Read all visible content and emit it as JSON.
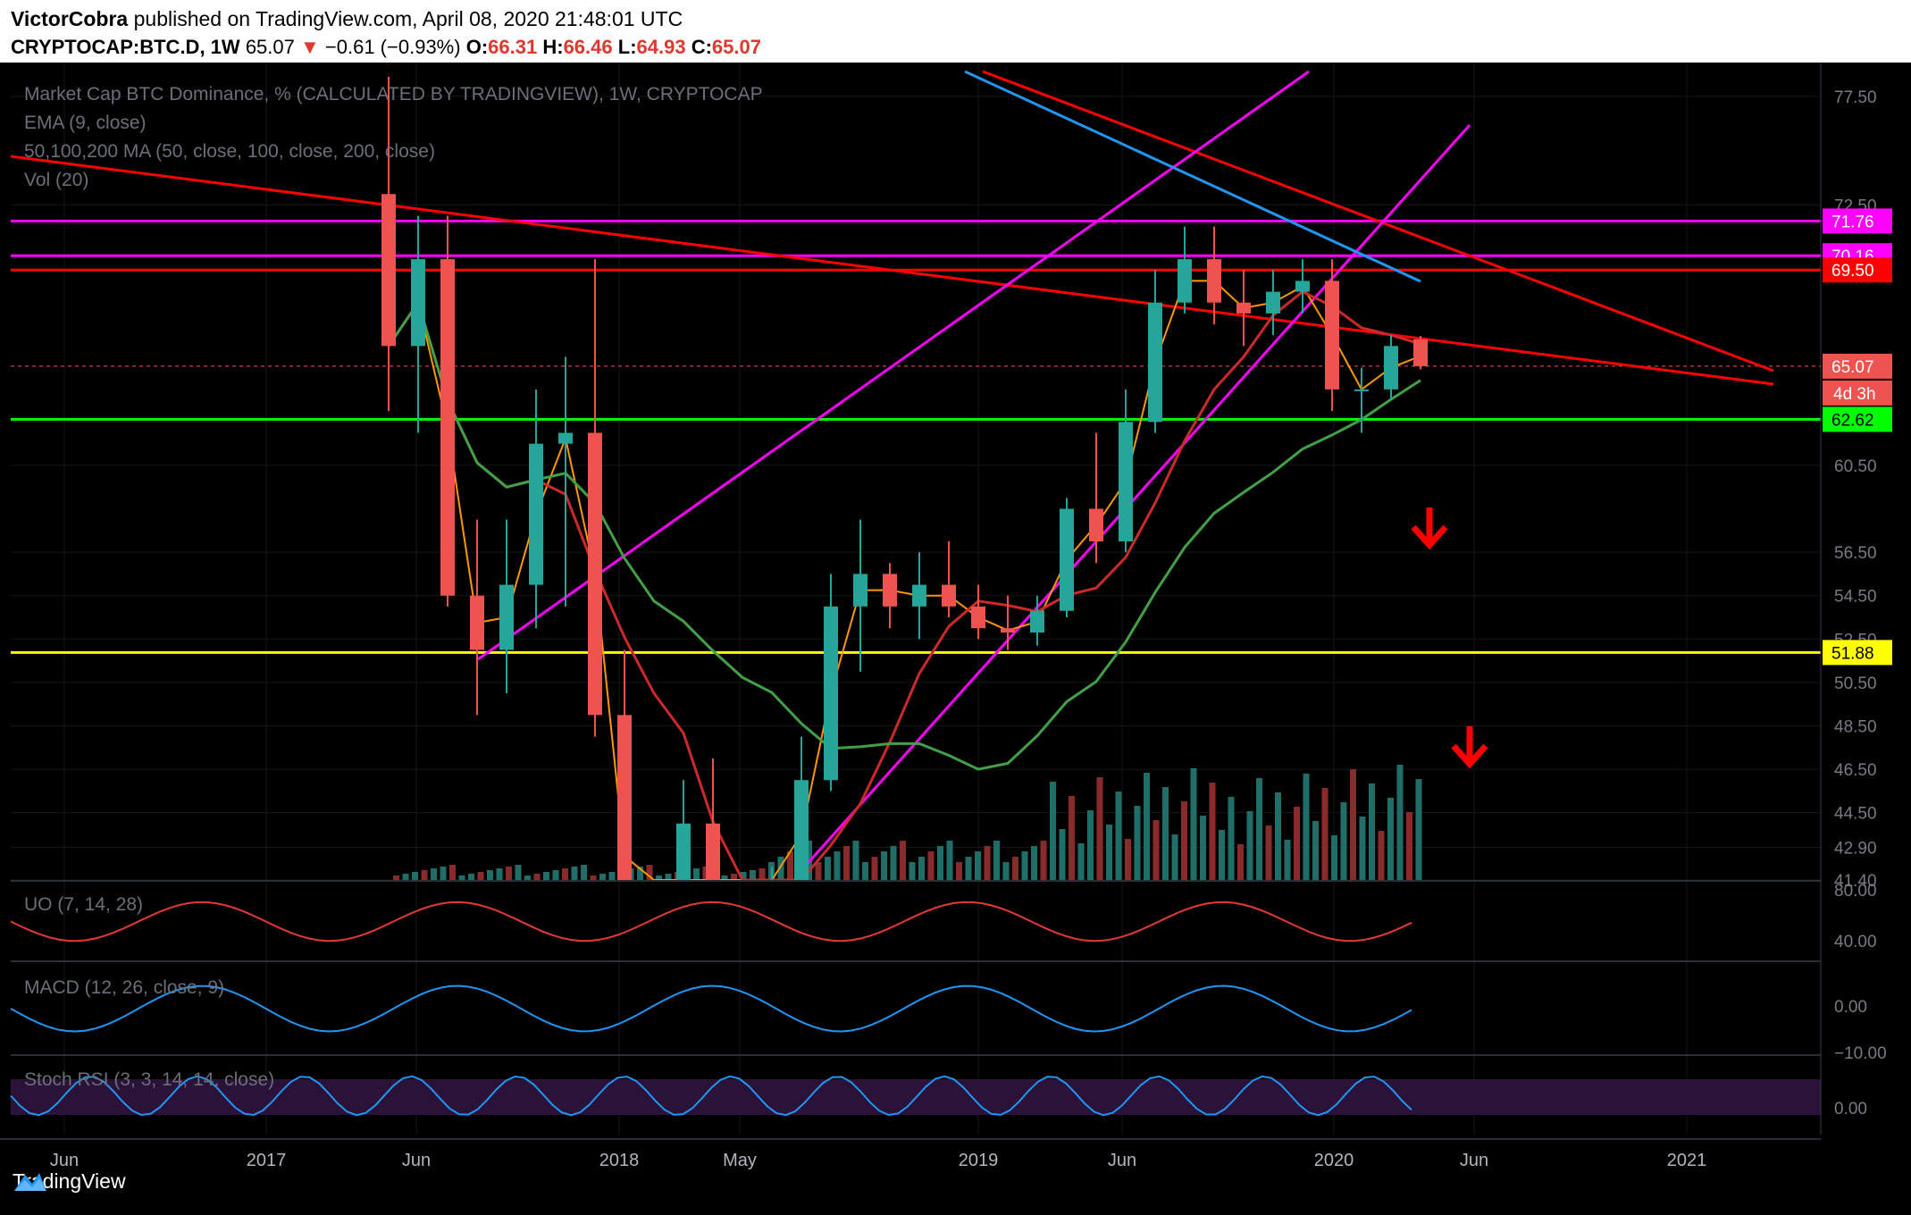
{
  "header": {
    "author": "VictorCobra",
    "published": " published on TradingView.com, April 08, 2020 21:48:01 UTC",
    "symbol": "CRYPTOCAP:BTC.D, 1W",
    "last": "65.07",
    "change": "−0.61 (−0.93%)",
    "o_label": "O:",
    "o": "66.31",
    "h_label": "H:",
    "h": "66.46",
    "l_label": "L:",
    "l": "64.93",
    "c_label": "C:",
    "c": "65.07"
  },
  "legends": {
    "title": "Market Cap BTC Dominance, % (CALCULATED BY TRADINGVIEW), 1W, CRYPTOCAP",
    "ema": "EMA (9, close)",
    "ma": "50,100,200 MA (50, close, 100, close, 200, close)",
    "vol": "Vol (20)",
    "uo": "UO (7, 14, 28)",
    "macd": "MACD (12, 26, close, 9)",
    "stoch": "Stoch RSI (3, 3, 14, 14, close)"
  },
  "footer": {
    "brand": "TradingView"
  },
  "colors": {
    "bg": "#000000",
    "up": "#26a69a",
    "down": "#ef5350",
    "magenta": "#ff00ff",
    "red": "#ff0000",
    "green_line": "#00ff00",
    "yellow": "#ffff00",
    "ema": "#ff9800",
    "ma50": "#cc2a2a",
    "ma100": "#43a047",
    "ma200": "#2196f3"
  },
  "chart_data": {
    "type": "candlestick",
    "timeframe": "1W",
    "x_ticks": [
      "Jun",
      "2017",
      "Jun",
      "2018",
      "May",
      "2019",
      "Jun",
      "2020",
      "Jun",
      "2021"
    ],
    "y_ticks": [
      77.5,
      72.5,
      60.5,
      56.5,
      54.5,
      52.5,
      50.5,
      48.5,
      46.5,
      44.5,
      42.9,
      41.4
    ],
    "y_tick_labels": [
      "77.50",
      "72.50",
      "60.50",
      "56.50",
      "54.50",
      "52.50",
      "50.50",
      "48.50",
      "46.50",
      "44.50",
      "42.90",
      "41.40"
    ],
    "y_range": [
      41.4,
      78.4
    ],
    "price_markers": [
      {
        "value": 71.76,
        "label": "71.76",
        "color": "#ff00ff"
      },
      {
        "value": 70.16,
        "label": "70.16",
        "color": "#ff00ff"
      },
      {
        "value": 69.5,
        "label": "69.50",
        "color": "#ff0000"
      },
      {
        "value": 65.07,
        "label": "65.07",
        "color": "#ef5350",
        "sub": "4d 3h"
      },
      {
        "value": 62.62,
        "label": "62.62",
        "color": "#00ff00"
      },
      {
        "value": 51.88,
        "label": "51.88",
        "color": "#ffff00"
      }
    ],
    "candles_approx": [
      {
        "t": "2017-05",
        "o": 73.0,
        "h": 78.4,
        "l": 63.0,
        "c": 66.0
      },
      {
        "t": "2017-06",
        "o": 66.0,
        "h": 72.0,
        "l": 62.0,
        "c": 70.0
      },
      {
        "t": "2017-07",
        "o": 70.0,
        "h": 72.0,
        "l": 54.0,
        "c": 54.5
      },
      {
        "t": "2017-08",
        "o": 54.5,
        "h": 58.0,
        "l": 49.0,
        "c": 52.0
      },
      {
        "t": "2017-09",
        "o": 52.0,
        "h": 58.0,
        "l": 50.0,
        "c": 55.0
      },
      {
        "t": "2017-10",
        "o": 55.0,
        "h": 64.0,
        "l": 53.0,
        "c": 61.5
      },
      {
        "t": "2017-11",
        "o": 61.5,
        "h": 65.5,
        "l": 54.0,
        "c": 62.0
      },
      {
        "t": "2017-12",
        "o": 62.0,
        "h": 70.0,
        "l": 48.0,
        "c": 49.0
      },
      {
        "t": "2018-01",
        "o": 49.0,
        "h": 52.0,
        "l": 33.0,
        "c": 36.0
      },
      {
        "t": "2018-02",
        "o": 36.0,
        "h": 38.0,
        "l": 33.5,
        "c": 36.5
      },
      {
        "t": "2018-03",
        "o": 36.5,
        "h": 46.0,
        "l": 36.0,
        "c": 44.0
      },
      {
        "t": "2018-04",
        "o": 44.0,
        "h": 47.0,
        "l": 36.0,
        "c": 37.0
      },
      {
        "t": "2018-05",
        "o": 37.0,
        "h": 38.5,
        "l": 33.0,
        "c": 36.0
      },
      {
        "t": "2018-06",
        "o": 36.0,
        "h": 42.0,
        "l": 35.5,
        "c": 41.0
      },
      {
        "t": "2018-07",
        "o": 41.0,
        "h": 48.0,
        "l": 40.5,
        "c": 46.0
      },
      {
        "t": "2018-08",
        "o": 46.0,
        "h": 55.5,
        "l": 45.5,
        "c": 54.0
      },
      {
        "t": "2018-09",
        "o": 54.0,
        "h": 58.0,
        "l": 51.0,
        "c": 55.5
      },
      {
        "t": "2018-10",
        "o": 55.5,
        "h": 56.0,
        "l": 53.0,
        "c": 54.0
      },
      {
        "t": "2018-11",
        "o": 54.0,
        "h": 56.5,
        "l": 52.5,
        "c": 55.0
      },
      {
        "t": "2018-12",
        "o": 55.0,
        "h": 57.0,
        "l": 53.5,
        "c": 54.0
      },
      {
        "t": "2019-01",
        "o": 54.0,
        "h": 55.0,
        "l": 52.5,
        "c": 53.0
      },
      {
        "t": "2019-02",
        "o": 53.0,
        "h": 54.5,
        "l": 52.0,
        "c": 52.8
      },
      {
        "t": "2019-03",
        "o": 52.8,
        "h": 54.5,
        "l": 52.2,
        "c": 53.8
      },
      {
        "t": "2019-04",
        "o": 53.8,
        "h": 59.0,
        "l": 53.5,
        "c": 58.5
      },
      {
        "t": "2019-05",
        "o": 58.5,
        "h": 62.0,
        "l": 56.0,
        "c": 57.0
      },
      {
        "t": "2019-06",
        "o": 57.0,
        "h": 64.0,
        "l": 56.5,
        "c": 62.5
      },
      {
        "t": "2019-07",
        "o": 62.5,
        "h": 69.5,
        "l": 62.0,
        "c": 68.0
      },
      {
        "t": "2019-08",
        "o": 68.0,
        "h": 71.5,
        "l": 67.5,
        "c": 70.0
      },
      {
        "t": "2019-09",
        "o": 70.0,
        "h": 71.5,
        "l": 67.0,
        "c": 68.0
      },
      {
        "t": "2019-10",
        "o": 68.0,
        "h": 69.5,
        "l": 66.0,
        "c": 67.5
      },
      {
        "t": "2019-11",
        "o": 67.5,
        "h": 69.5,
        "l": 66.5,
        "c": 68.5
      },
      {
        "t": "2019-12",
        "o": 68.5,
        "h": 70.0,
        "l": 67.5,
        "c": 69.0
      },
      {
        "t": "2020-01",
        "o": 69.0,
        "h": 70.0,
        "l": 63.0,
        "c": 64.0
      },
      {
        "t": "2020-02",
        "o": 64.0,
        "h": 65.0,
        "l": 62.0,
        "c": 64.0
      },
      {
        "t": "2020-03",
        "o": 64.0,
        "h": 66.5,
        "l": 63.5,
        "c": 66.0
      },
      {
        "t": "2020-04",
        "o": 66.31,
        "h": 66.46,
        "l": 64.93,
        "c": 65.07
      }
    ],
    "ultimate_oscillator": {
      "ticks": [
        "80.00",
        "40.00"
      ]
    },
    "macd": {
      "ticks": [
        "0.00",
        "−10.00"
      ]
    },
    "stoch_rsi": {
      "ticks": [
        "0.00"
      ]
    }
  }
}
